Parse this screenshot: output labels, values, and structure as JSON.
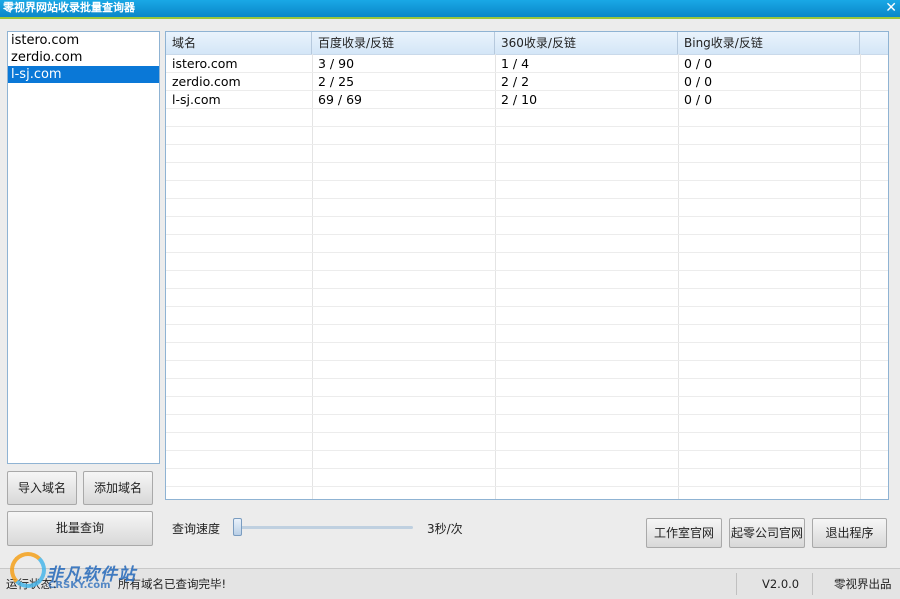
{
  "window": {
    "title": "零视界网站收录批量查询器",
    "close_glyph": "✕"
  },
  "domain_list": {
    "items": [
      "istero.com",
      "zerdio.com",
      "l-sj.com"
    ],
    "selected_index": 2
  },
  "buttons": {
    "import": "导入域名",
    "add": "添加域名",
    "batch_query": "批量查询",
    "studio_site": "工作室官网",
    "company_site": "起零公司官网",
    "exit": "退出程序"
  },
  "table": {
    "columns": [
      "域名",
      "百度收录/反链",
      "360收录/反链",
      "Bing收录/反链"
    ],
    "rows": [
      [
        "istero.com",
        "3 / 90",
        "1 / 4",
        "0 / 0"
      ],
      [
        "zerdio.com",
        "2 / 25",
        "2 / 2",
        "0 / 0"
      ],
      [
        "l-sj.com",
        "69 / 69",
        "2 / 10",
        "0 / 0"
      ]
    ]
  },
  "speed": {
    "label": "查询速度",
    "value_text": "3秒/次",
    "level": 0.0
  },
  "status": {
    "left_text": "运行状态：",
    "message": "所有域名已查询完毕!",
    "version": "V2.0.0",
    "publisher": "零视界出品"
  },
  "watermark": {
    "cn": "非凡软件站",
    "en": "CRSKY.com"
  }
}
